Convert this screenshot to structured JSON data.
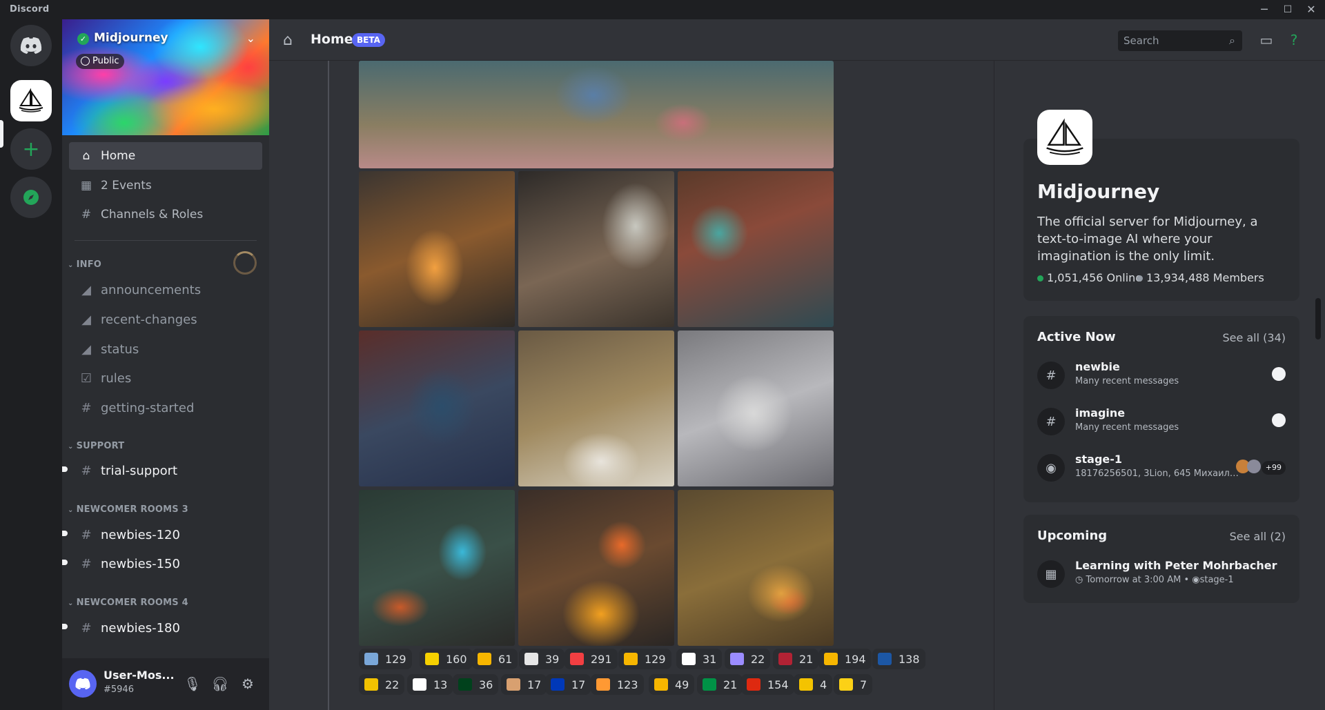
{
  "window": {
    "app_name": "Discord"
  },
  "server": {
    "name": "Midjourney",
    "visibility": "Public"
  },
  "sidebar": {
    "nav": [
      {
        "label": "Home",
        "icon": "home-icon",
        "active": true
      },
      {
        "label": "2 Events",
        "icon": "calendar-icon"
      },
      {
        "label": "Channels & Roles",
        "icon": "channels-roles-icon"
      }
    ],
    "categories": [
      {
        "name": "INFO",
        "channels": [
          {
            "name": "announcements",
            "icon": "megaphone-icon"
          },
          {
            "name": "recent-changes",
            "icon": "megaphone-icon"
          },
          {
            "name": "status",
            "icon": "megaphone-icon"
          },
          {
            "name": "rules",
            "icon": "checkbox-icon"
          },
          {
            "name": "getting-started",
            "icon": "hash-icon"
          }
        ]
      },
      {
        "name": "SUPPORT",
        "channels": [
          {
            "name": "trial-support",
            "icon": "hash-icon",
            "unread": true
          }
        ]
      },
      {
        "name": "NEWCOMER ROOMS 3",
        "channels": [
          {
            "name": "newbies-120",
            "icon": "threaded-hash-icon",
            "unread": true
          },
          {
            "name": "newbies-150",
            "icon": "threaded-hash-icon",
            "unread": true
          }
        ]
      },
      {
        "name": "NEWCOMER ROOMS 4",
        "channels": [
          {
            "name": "newbies-180",
            "icon": "threaded-hash-icon",
            "unread": true
          }
        ]
      }
    ]
  },
  "user": {
    "name": "User-Mos...",
    "tag": "#5946"
  },
  "topbar": {
    "title": "Home",
    "badge": "BETA",
    "search_placeholder": "Search"
  },
  "reactions": [
    [
      {
        "emoji": "wizard",
        "count": "129",
        "color": "#7aa7d8"
      },
      {
        "emoji": "flag-ukraine",
        "count": "160",
        "color": "#f5d000"
      },
      {
        "emoji": "star",
        "count": "61",
        "color": "#f7b600"
      },
      {
        "emoji": "envelope",
        "count": "39",
        "color": "#e6e6e6"
      },
      {
        "emoji": "heart",
        "count": "291",
        "color": "#f23f42"
      },
      {
        "emoji": "star-struck",
        "count": "129",
        "color": "#f7b600"
      },
      {
        "emoji": "flag-japan",
        "count": "31",
        "color": "#ffffff"
      },
      {
        "emoji": "rocket",
        "count": "22",
        "color": "#9b8cff"
      },
      {
        "emoji": "flag-us",
        "count": "21",
        "color": "#b22234"
      },
      {
        "emoji": "thumbs-up",
        "count": "194",
        "color": "#f7b600"
      },
      {
        "emoji": "flag-russia",
        "count": "138",
        "color": "#1c57a5"
      }
    ],
    [
      {
        "emoji": "sailboat-yellow",
        "count": "22",
        "color": "#f2c200"
      },
      {
        "emoji": "flag-georgia",
        "count": "13",
        "color": "#ffffff"
      },
      {
        "emoji": "flag-pakistan",
        "count": "36",
        "color": "#01411c"
      },
      {
        "emoji": "writing-hand",
        "count": "17",
        "color": "#d8a070"
      },
      {
        "emoji": "flag-israel",
        "count": "17",
        "color": "#0038b8"
      },
      {
        "emoji": "flag-india",
        "count": "123",
        "color": "#ff9933"
      },
      {
        "emoji": "ok-hand",
        "count": "49",
        "color": "#f7b600"
      },
      {
        "emoji": "flag-italy",
        "count": "21",
        "color": "#009246"
      },
      {
        "emoji": "flag-china",
        "count": "154",
        "color": "#de2910"
      },
      {
        "emoji": "flag-venezuela",
        "count": "4",
        "color": "#f4c300"
      },
      {
        "emoji": "flag-romania",
        "count": "7",
        "color": "#fcd116"
      }
    ]
  ],
  "about": {
    "name": "Midjourney",
    "description": "The official server for Midjourney, a text-to-image AI where your imagination is the only limit.",
    "online": "1,051,456 Online",
    "members": "13,934,488 Members"
  },
  "active_now": {
    "title": "Active Now",
    "see_all": "See all (34)",
    "items": [
      {
        "name": "newbie",
        "sub": "Many recent messages",
        "icon": "hash-icon"
      },
      {
        "name": "imagine",
        "sub": "Many recent messages",
        "icon": "hash-icon"
      },
      {
        "name": "stage-1",
        "sub": "18176256501, 3Lion, 645 Михаил Р...",
        "icon": "stage-icon",
        "extra": "+99"
      }
    ]
  },
  "upcoming": {
    "title": "Upcoming",
    "see_all": "See all (2)",
    "event": {
      "name": "Learning with Peter Mohrbacher",
      "time": "Tomorrow at 3:00 AM • ",
      "location": "stage-1"
    }
  },
  "colors": {
    "accent": "#5865f2",
    "online": "#23a559",
    "offline": "#949ba4"
  }
}
